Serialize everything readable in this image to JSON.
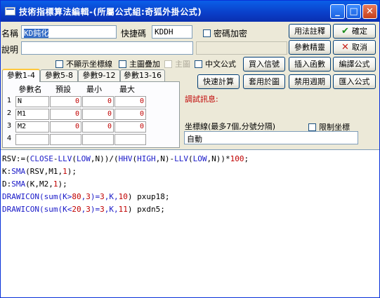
{
  "window": {
    "title": "技術指標算法編輯-(所屬公式組:奇狐外掛公式)",
    "min_label": "_",
    "max_label": "□",
    "close_label": "✕"
  },
  "form": {
    "name_label": "名稱",
    "name_value": "KD鈍化",
    "shortcut_label": "快捷碼",
    "shortcut_value": "KDDH",
    "password_label": "密碼加密",
    "desc_label": "說明",
    "desc_value": ""
  },
  "right_buttons": {
    "usage": "用法註釋",
    "ok": "確定",
    "params": "參數精靈",
    "cancel": "取消",
    "insert_func": "插入函數",
    "compile": "編譯公式",
    "debug_buttons": {
      "buy_signal": "買入信號",
      "quick_calc": "快速計算",
      "apply_chart": "套用於圖",
      "disable_period": "禁用週期",
      "import_formula": "匯入公式"
    }
  },
  "options": {
    "hide_axis": "不顯示坐標線",
    "main_overlay": "主圖疊加",
    "main_chart": "主圖",
    "chinese_formula": "中文公式",
    "limit_axis": "限制坐標"
  },
  "tabs": [
    "參數1-4",
    "參數5-8",
    "參數9-12",
    "參數13-16"
  ],
  "param_table": {
    "headers": [
      "參數名",
      "預設",
      "最小",
      "最大"
    ],
    "rows": [
      {
        "no": "1",
        "name": "N",
        "default": "0",
        "min": "0",
        "max": "0"
      },
      {
        "no": "2",
        "name": "M1",
        "default": "0",
        "min": "0",
        "max": "0"
      },
      {
        "no": "3",
        "name": "M2",
        "default": "0",
        "min": "0",
        "max": "0"
      },
      {
        "no": "4",
        "name": "",
        "default": "",
        "min": "",
        "max": ""
      }
    ]
  },
  "debug_label": "調試訊息:",
  "axis": {
    "label": "坐標線(最多7個,分號分隔)",
    "value": "自動"
  },
  "code_lines": [
    [
      {
        "t": "RSV:=(",
        "c": "plain"
      },
      {
        "t": "CLOSE",
        "c": "kw"
      },
      {
        "t": "-",
        "c": "plain"
      },
      {
        "t": "LLV",
        "c": "kw"
      },
      {
        "t": "(",
        "c": "plain"
      },
      {
        "t": "LOW",
        "c": "kw"
      },
      {
        "t": ",N))/(",
        "c": "plain"
      },
      {
        "t": "HHV",
        "c": "kw"
      },
      {
        "t": "(",
        "c": "plain"
      },
      {
        "t": "HIGH",
        "c": "kw"
      },
      {
        "t": ",N)-",
        "c": "plain"
      },
      {
        "t": "LLV",
        "c": "kw"
      },
      {
        "t": "(",
        "c": "plain"
      },
      {
        "t": "LOW",
        "c": "kw"
      },
      {
        "t": ",N))*",
        "c": "plain"
      },
      {
        "t": "100",
        "c": "num"
      },
      {
        "t": ";",
        "c": "plain"
      }
    ],
    [
      {
        "t": "K:",
        "c": "plain"
      },
      {
        "t": "SMA",
        "c": "kw"
      },
      {
        "t": "(RSV,M1,",
        "c": "plain"
      },
      {
        "t": "1",
        "c": "num"
      },
      {
        "t": ");",
        "c": "plain"
      }
    ],
    [
      {
        "t": "D:",
        "c": "plain"
      },
      {
        "t": "SMA",
        "c": "kw"
      },
      {
        "t": "(K,M2,",
        "c": "plain"
      },
      {
        "t": "1",
        "c": "num"
      },
      {
        "t": ");",
        "c": "plain"
      }
    ],
    [
      {
        "t": "DRAWICON",
        "c": "kw"
      },
      {
        "t": "(sum(K>",
        "c": "kw"
      },
      {
        "t": "80",
        "c": "num"
      },
      {
        "t": ",",
        "c": "kw"
      },
      {
        "t": "3",
        "c": "num"
      },
      {
        "t": ")=",
        "c": "kw"
      },
      {
        "t": "3",
        "c": "num"
      },
      {
        "t": ",K,",
        "c": "kw"
      },
      {
        "t": "10",
        "c": "num"
      },
      {
        "t": ") pxup18;",
        "c": "plain"
      }
    ],
    [
      {
        "t": "DRAWICON",
        "c": "kw"
      },
      {
        "t": "(sum(K<",
        "c": "kw"
      },
      {
        "t": "20",
        "c": "num"
      },
      {
        "t": ",",
        "c": "kw"
      },
      {
        "t": "3",
        "c": "num"
      },
      {
        "t": ")=",
        "c": "kw"
      },
      {
        "t": "3",
        "c": "num"
      },
      {
        "t": ",K,",
        "c": "kw"
      },
      {
        "t": "11",
        "c": "num"
      },
      {
        "t": ") pxdn5;",
        "c": "plain"
      }
    ]
  ],
  "colors": {
    "titlebar": "#0a3ec8",
    "keyword": "#1a1ac8",
    "number": "#c00000",
    "debug": "#c00000"
  },
  "icons": {
    "ok": "check-icon",
    "cancel": "x-icon"
  }
}
